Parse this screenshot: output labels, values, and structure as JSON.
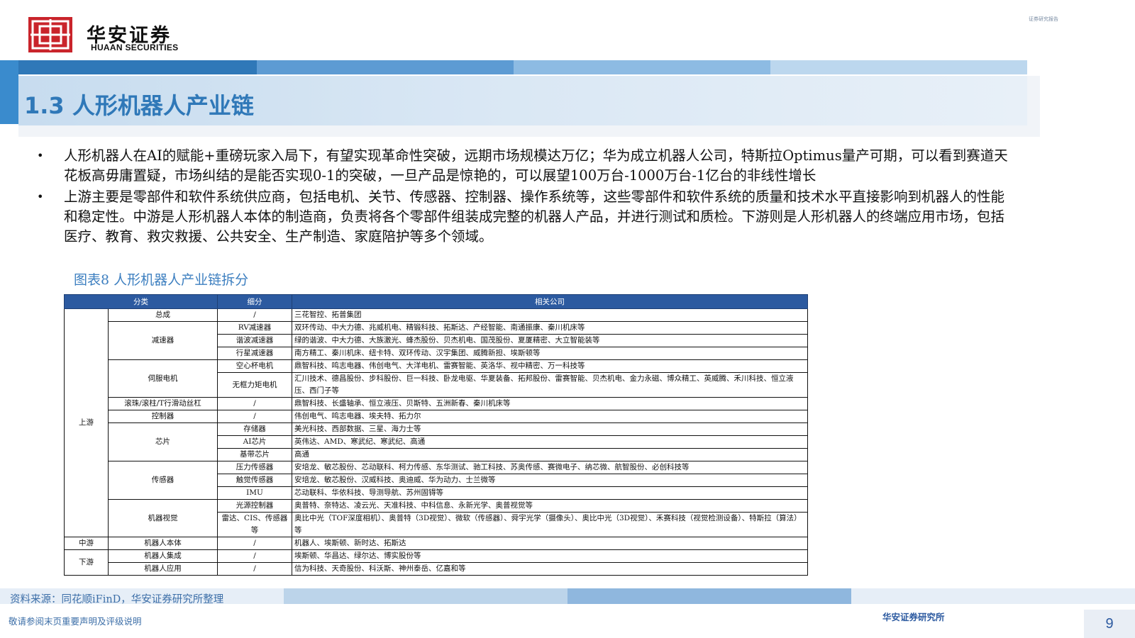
{
  "header": {
    "brand_cn": "华安证券",
    "brand_en": "HUAAN SECURITIES",
    "top_note": "证券研究报告",
    "colors": {
      "logo_red": "#c9242b",
      "accent_blue": "#2f78b8"
    }
  },
  "title": "1.3 人形机器人产业链",
  "bullets": [
    "人形机器人在AI的赋能+重磅玩家入局下，有望实现革命性突破，远期市场规模达万亿；华为成立机器人公司，特斯拉Optimus量产可期，可以看到赛道天花板高毋庸置疑，市场纠结的是能否实现0-1的突破，一旦产品是惊艳的，可以展望100万台-1000万台-1亿台的非线性增长",
    "上游主要是零部件和软件系统供应商，包括电机、关节、传感器、控制器、操作系统等，这些零部件和软件系统的质量和技术水平直接影响到机器人的性能和稳定性。中游是人形机器人本体的制造商，负责将各个零部件组装成完整的机器人产品，并进行测试和质检。下游则是人形机器人的终端应用市场，包括医疗、教育、救灾救援、公共安全、生产制造、家庭陪护等多个领域。"
  ],
  "chart_title": "图表8 人形机器人产业链拆分",
  "table": {
    "headers": [
      "分类",
      "细分",
      "相关公司"
    ],
    "stages": [
      "上游",
      "中游",
      "下游"
    ],
    "cells": {
      "r0_cat": "总成",
      "r0_sub": "/",
      "r0_co": "三花智控、拓普集团",
      "r1_cat": "减速器",
      "r1_sub": "RV减速器",
      "r1_co": "双环传动、中大力德、兆威机电、精锻科技、拓斯达、产经智能、南通振康、秦川机床等",
      "r2_sub": "谐波减速器",
      "r2_co": "绿的谐波、中大力德、大族激光、蜂杰股份、贝杰机电、国茂股份、夏厦精密、大立智能装等",
      "r3_sub": "行星减速器",
      "r3_co": "南方精工、秦川机床、纽卡特、双环传动、汉宇集团、威腾新担、埃斯顿等",
      "r4_cat": "伺服电机",
      "r4_sub": "空心杯电机",
      "r4_co": "鼎智科技、鸣志电器、伟创电气、大洋电机、雷赛智能、英洛华、视中精密、万一科技等",
      "r5_sub": "无框力矩电机",
      "r5_co": "汇川技术、德昌股份、步科股份、巨一科技、卧龙电驱、华夏装备、拓邦股份、雷赛智能、贝杰机电、金力永磁、博众精工、英威腾、禾川科技、恒立液压、西门子等",
      "r6_cat": "滚珠/滚柱/T行滑动丝杠",
      "r6_sub": "/",
      "r6_co": "鼎智科技、长盛轴承、恒立液压、贝斯特、五洲新春、秦川机床等",
      "r7_cat": "控制器",
      "r7_sub": "/",
      "r7_co": "伟创电气、鸣志电器、埃夫特、拓力尔",
      "r8_cat": "芯片",
      "r8_sub": "存储器",
      "r8_co": "美光科技、西部数据、三星、海力士等",
      "r9_sub": "AI芯片",
      "r9_co": "英伟达、AMD、寒武纪、寒武纪、高通",
      "r10_sub": "基带芯片",
      "r10_co": "高通",
      "r11_cat": "传感器",
      "r11_sub": "压力传感器",
      "r11_co": "安培龙、敏芯股份、芯动联科、柯力传感、东华测试、驰工科技、苏奥传感、赛微电子、纳芯微、航智股份、必创科技等",
      "r12_sub": "触觉传感器",
      "r12_co": "安培龙、敏芯股份、汉威科技、奥迪威、华为动力、士兰微等",
      "r13_sub": "IMU",
      "r13_co": "芯动联科、华依科技、导测导航、苏州固锝等",
      "r14_cat": "机器视觉",
      "r14_sub": "光源控制器",
      "r14_co": "奥普特、奈特达、凌云光、天准科技、中科信息、永新光学、奥普视觉等",
      "r15_sub": "雷达、CIS、传感器等",
      "r15_co": "奥比中光（TOF深度相机）、奥普特（3D视觉）、微软（传感器）、舜宇光学（摄像头）、奥比中光（3D视觉）、禾赛科技（视觉检测设备）、特斯拉（算法）等",
      "r16_cat": "机器人本体",
      "r16_sub": "/",
      "r16_co": "机器人、埃斯顿、新时达、拓斯达",
      "r17_cat": "机器人集成",
      "r17_sub": "/",
      "r17_co": "埃斯顿、华昌达、绿尔达、博实股份等",
      "r18_cat": "机器人应用",
      "r18_sub": "/",
      "r18_co": "信为科技、天奇股份、科沃斯、神州泰岳、亿嘉和等"
    }
  },
  "footer": {
    "source": "资料来源：同花顺iFinD，华安证券研究所整理",
    "disclaimer": "敬请参阅末页重要声明及评级说明",
    "brand": "华安证券研究所",
    "page_number": "9"
  }
}
